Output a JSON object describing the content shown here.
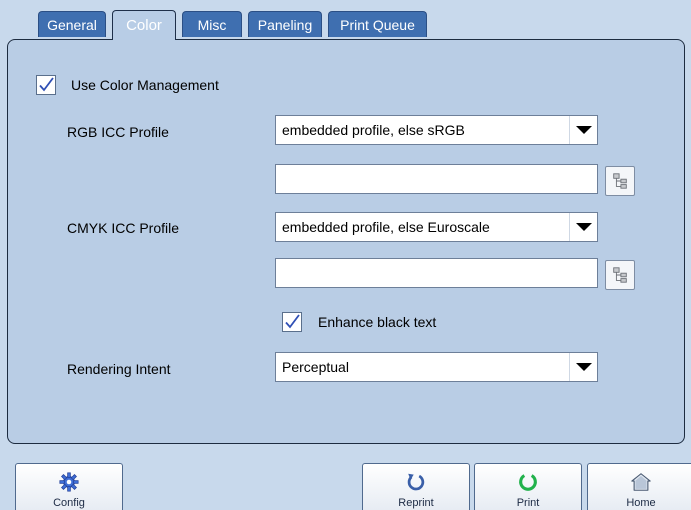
{
  "tabs": [
    {
      "label": "General",
      "active": false
    },
    {
      "label": "Color",
      "active": true
    },
    {
      "label": "Misc",
      "active": false
    },
    {
      "label": "Paneling",
      "active": false
    },
    {
      "label": "Print Queue",
      "active": false
    }
  ],
  "color": {
    "use_color_management": {
      "label": "Use Color Management",
      "checked": true
    },
    "rgb_profile": {
      "label": "RGB ICC Profile",
      "value": "embedded profile, else sRGB",
      "path_value": ""
    },
    "cmyk_profile": {
      "label": "CMYK ICC Profile",
      "value": "embedded profile, else Euroscale",
      "path_value": ""
    },
    "enhance_black_text": {
      "label": "Enhance black text",
      "checked": true
    },
    "rendering_intent": {
      "label": "Rendering Intent",
      "value": "Perceptual"
    }
  },
  "toolbar": {
    "config_label": "Config",
    "reprint_label": "Reprint",
    "print_label": "Print",
    "home_label": "Home"
  },
  "icons": {
    "config": "gear-icon",
    "reprint": "refresh-icon",
    "print": "print-icon",
    "home": "home-icon",
    "browse": "folder-tree-icon"
  },
  "colors": {
    "tab_blue": "#3f6fb0",
    "panel_bg": "#b9cde5",
    "page_bg": "#c8d9ec",
    "check_blue": "#2f4fb5",
    "print_green": "#22b24c",
    "reprint_blue": "#3a5fa8"
  }
}
